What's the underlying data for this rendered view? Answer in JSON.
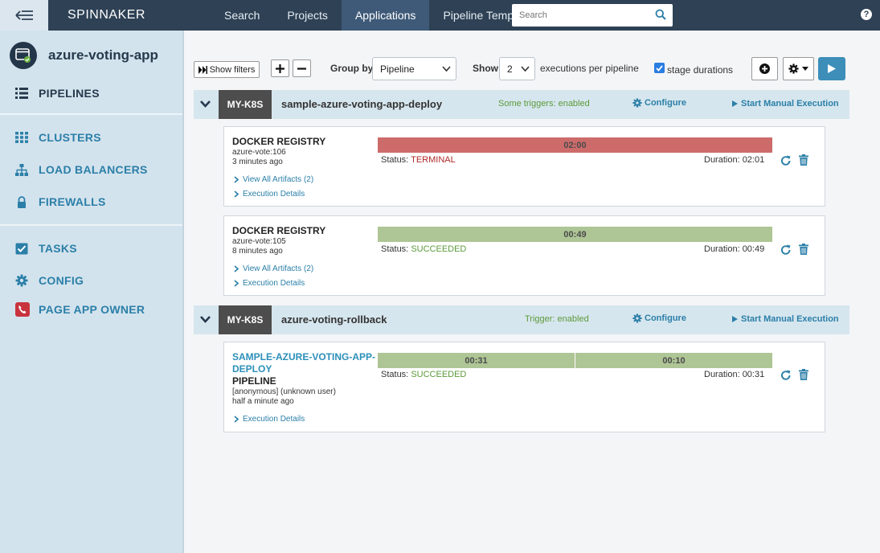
{
  "nav": {
    "brand": "SPINNAKER",
    "links": [
      "Search",
      "Projects",
      "Applications",
      "Pipeline Templates"
    ],
    "search_placeholder": "Search",
    "help": "?"
  },
  "colors": {
    "nav_bg": "#2e4155",
    "accent": "#2b7fa8",
    "terminal": "#cd6b6b",
    "succeeded": "#aec595"
  },
  "sidebar": {
    "app_name": "azure-voting-app",
    "items": [
      "PIPELINES",
      "CLUSTERS",
      "LOAD BALANCERS",
      "FIREWALLS",
      "TASKS",
      "CONFIG",
      "PAGE APP OWNER"
    ]
  },
  "toolbar": {
    "show_filters": "Show filters",
    "group_by_label": "Group by",
    "group_by_value": "Pipeline",
    "show_label": "Show",
    "show_value": "2",
    "per_pipeline": "executions per pipeline",
    "stage_durations": "stage durations"
  },
  "groups": [
    {
      "account": "MY-K8S",
      "name": "sample-azure-voting-app-deploy",
      "triggers": "Some triggers: enabled",
      "configure": "Configure",
      "start": "Start Manual Execution",
      "executions": [
        {
          "title": "DOCKER REGISTRY",
          "line1": "azure-vote:106",
          "line2": "3 minutes ago",
          "artifacts": "View All Artifacts (2)",
          "details": "Execution Details",
          "bar_label": "02:00",
          "status_label": "Status:",
          "status": "TERMINAL",
          "duration": "Duration: 02:01"
        },
        {
          "title": "DOCKER REGISTRY",
          "line1": "azure-vote:105",
          "line2": "8 minutes ago",
          "artifacts": "View All Artifacts (2)",
          "details": "Execution Details",
          "bar_label": "00:49",
          "status_label": "Status:",
          "status": "SUCCEEDED",
          "duration": "Duration: 00:49"
        }
      ]
    },
    {
      "account": "MY-K8S",
      "name": "azure-voting-rollback",
      "triggers": "Trigger: enabled",
      "configure": "Configure",
      "start": "Start Manual Execution",
      "executions": [
        {
          "title_link_1": "SAMPLE-AZURE-VOTING-APP-",
          "title_link_2": "DEPLOY",
          "title": "PIPELINE",
          "line1": "[anonymous] (unknown user)",
          "line2": "half a minute ago",
          "details": "Execution Details",
          "bar_label_1": "00:31",
          "bar_label_2": "00:10",
          "status_label": "Status:",
          "status": "SUCCEEDED",
          "duration": "Duration: 00:31"
        }
      ]
    }
  ]
}
